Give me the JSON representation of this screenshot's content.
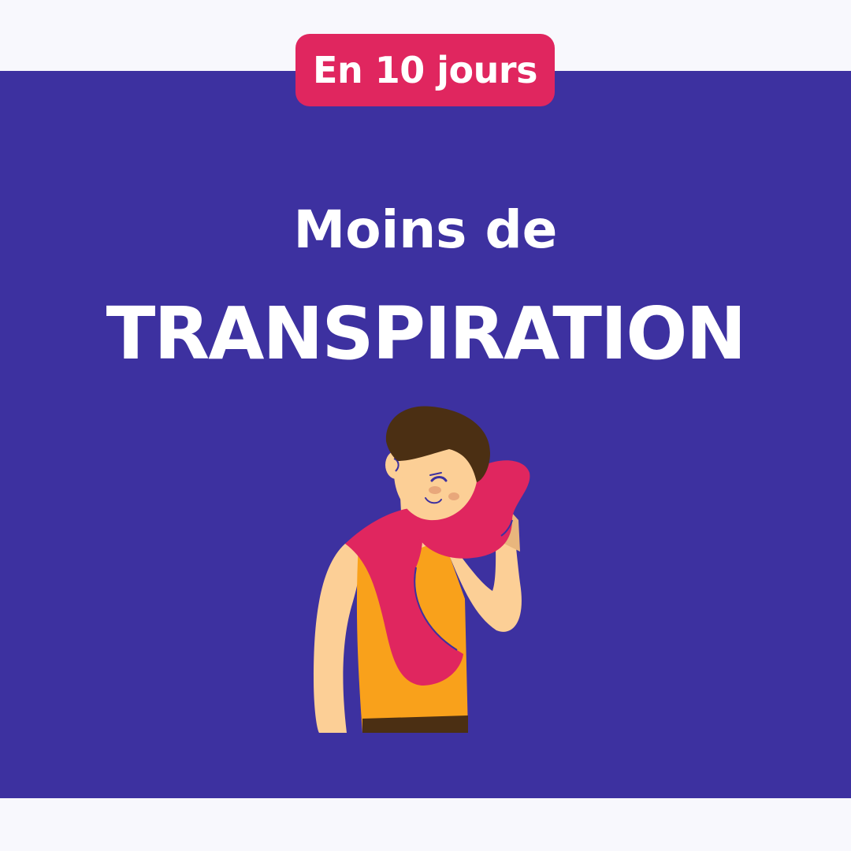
{
  "badge": {
    "label": "En 10 jours"
  },
  "headline": {
    "line1": "Moins de",
    "line2": "TRANSPIRATION"
  },
  "colors": {
    "background": "#f8f8fd",
    "panel": "#3d31a0",
    "badge": "#e0265f",
    "text": "#ffffff",
    "shirt": "#f9a11b",
    "towel": "#e0265f",
    "skin": "#fccf96",
    "hair": "#4b2f13"
  },
  "illustration": {
    "icon": "sweating-man-with-towel-icon"
  }
}
